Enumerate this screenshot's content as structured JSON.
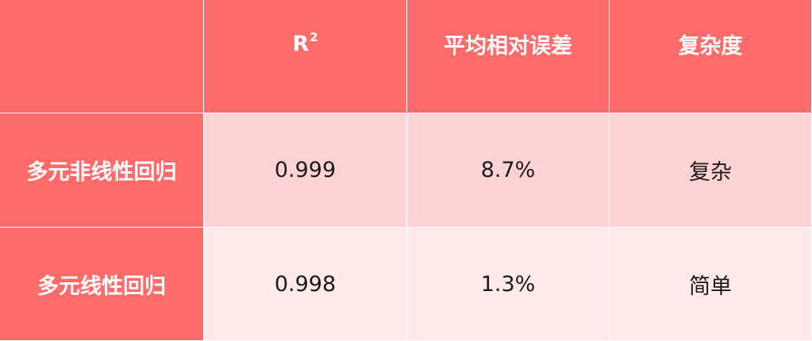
{
  "table": {
    "headers": [
      "",
      "R",
      "平均相对误差",
      "复杂度"
    ],
    "r_superscript": "2",
    "rows": [
      {
        "label": "多元非线性回归",
        "r2": "0.999",
        "error": "8.7%",
        "complexity": "复杂"
      },
      {
        "label": "多元线性回归",
        "r2": "0.998",
        "error": "1.3%",
        "complexity": "简单"
      }
    ]
  },
  "colors": {
    "header": "#ff6b6b",
    "row1": "#ffd3d3",
    "row2": "#ffe9e9",
    "grid": "#ffffff"
  }
}
